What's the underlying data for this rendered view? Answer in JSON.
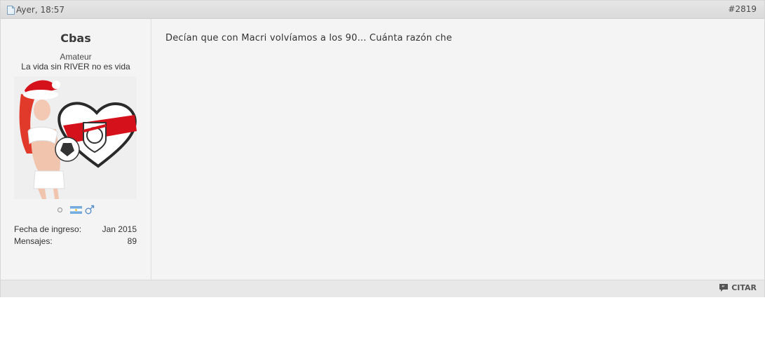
{
  "post": {
    "date": "Ayer, 18:57",
    "number": "#2819",
    "message": "Decían que con Macri volvíamos a los 90... Cuánta razón che"
  },
  "user": {
    "name": "Cbas",
    "title": "Amateur",
    "motto": "La vida sin RIVER no es vida",
    "stats": [
      {
        "label": "Fecha de ingreso:",
        "value": "Jan 2015"
      },
      {
        "label": "Mensajes:",
        "value": "89"
      }
    ]
  },
  "actions": {
    "quote_label": "CITAR"
  },
  "colors": {
    "river_red": "#d5121b",
    "header_bg": "#dadada",
    "body_bg": "#f4f4f5"
  }
}
